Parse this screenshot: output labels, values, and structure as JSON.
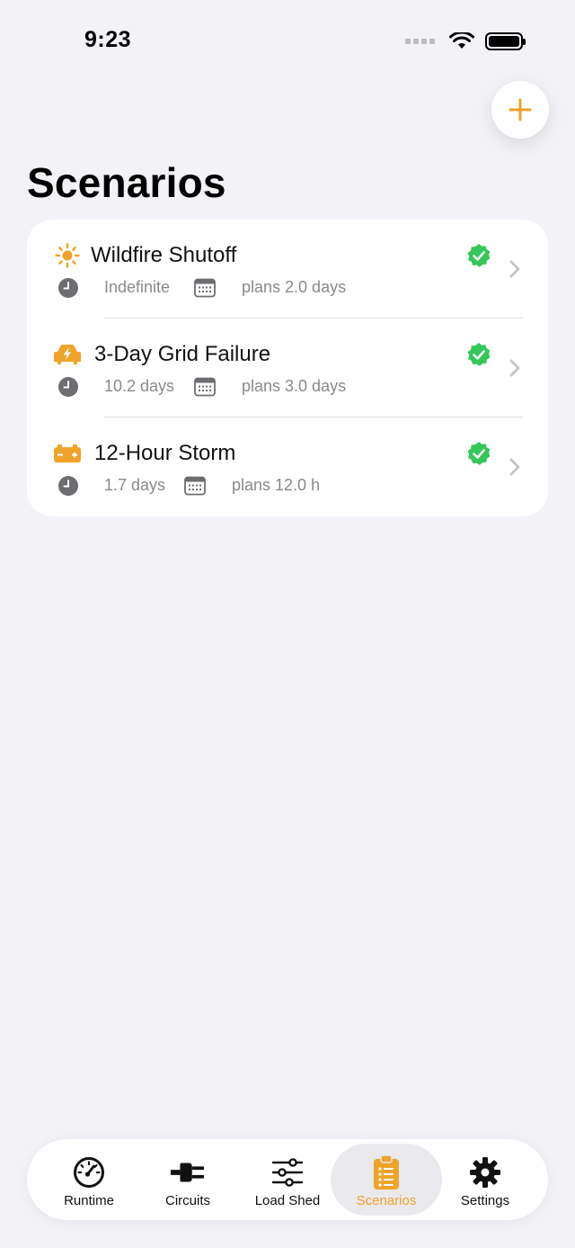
{
  "status_bar": {
    "time": "9:23"
  },
  "header": {
    "title": "Scenarios"
  },
  "colors": {
    "accent": "#F0A32A",
    "badge": "#34C759",
    "secondary_text": "#8A8A8E"
  },
  "scenarios": [
    {
      "icon": "sun-icon",
      "title": "Wildfire Shutoff",
      "runtime": "Indefinite",
      "plan": "plans 2.0 days",
      "verified": true
    },
    {
      "icon": "car-bolt-icon",
      "title": "3-Day Grid Failure",
      "runtime": "10.2 days",
      "plan": "plans 3.0 days",
      "verified": true
    },
    {
      "icon": "battery-icon",
      "title": "12-Hour Storm",
      "runtime": "1.7 days",
      "plan": "plans 12.0 h",
      "verified": true
    }
  ],
  "tabs": [
    {
      "label": "Runtime",
      "icon": "gauge-icon",
      "active": false
    },
    {
      "label": "Circuits",
      "icon": "plug-icon",
      "active": false
    },
    {
      "label": "Load Shed",
      "icon": "sliders-icon",
      "active": false
    },
    {
      "label": "Scenarios",
      "icon": "clipboard-icon",
      "active": true
    },
    {
      "label": "Settings",
      "icon": "gear-icon",
      "active": false
    }
  ]
}
